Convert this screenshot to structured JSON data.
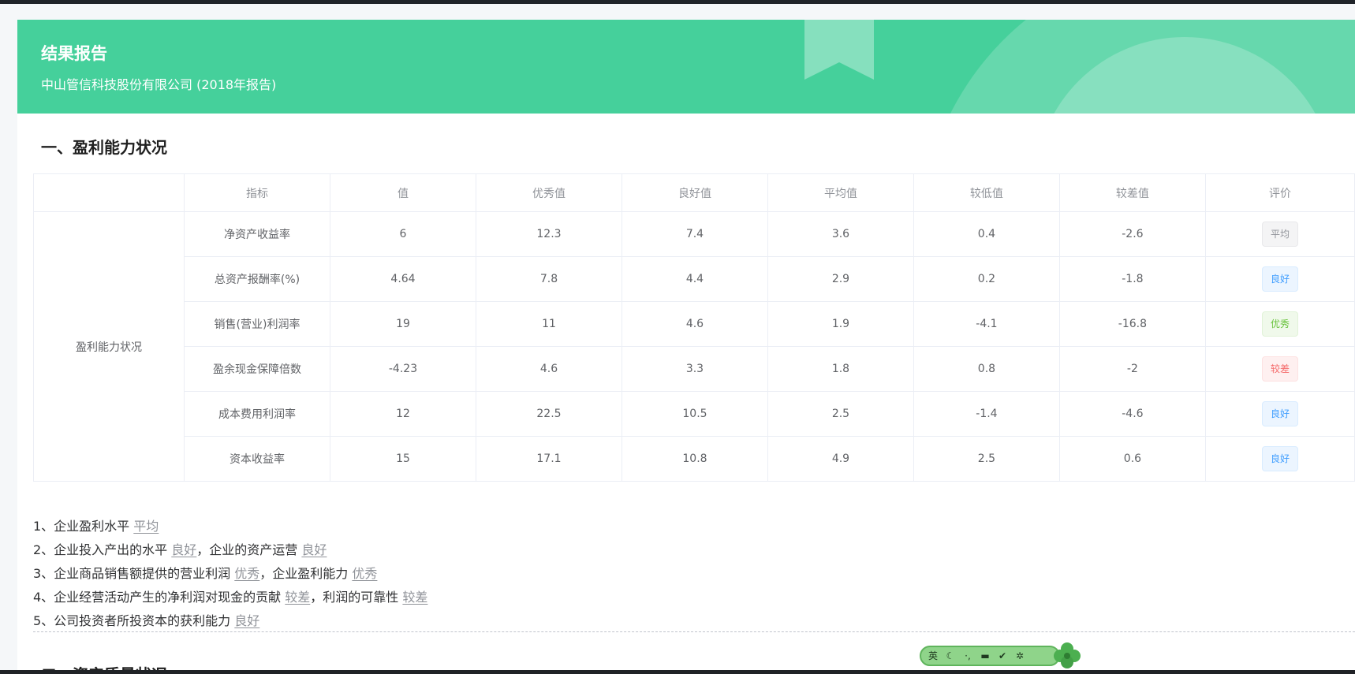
{
  "banner": {
    "title": "结果报告",
    "subtitle": "中山管信科技股份有限公司 (2018年报告)"
  },
  "section1": {
    "title": "一、盈利能力状况",
    "category": "盈利能力状况",
    "headers": [
      "",
      "指标",
      "值",
      "优秀值",
      "良好值",
      "平均值",
      "较低值",
      "较差值",
      "评价"
    ],
    "rows": [
      {
        "name": "净资产收益率",
        "value": "6",
        "excellent": "12.3",
        "good": "7.4",
        "average": "3.6",
        "low": "0.4",
        "poor": "-2.6",
        "rating": "平均"
      },
      {
        "name": "总资产报酬率(%)",
        "value": "4.64",
        "excellent": "7.8",
        "good": "4.4",
        "average": "2.9",
        "low": "0.2",
        "poor": "-1.8",
        "rating": "良好"
      },
      {
        "name": "销售(营业)利润率",
        "value": "19",
        "excellent": "11",
        "good": "4.6",
        "average": "1.9",
        "low": "-4.1",
        "poor": "-16.8",
        "rating": "优秀"
      },
      {
        "name": "盈余现金保障倍数",
        "value": "-4.23",
        "excellent": "4.6",
        "good": "3.3",
        "average": "1.8",
        "low": "0.8",
        "poor": "-2",
        "rating": "较差"
      },
      {
        "name": "成本费用利润率",
        "value": "12",
        "excellent": "22.5",
        "good": "10.5",
        "average": "2.5",
        "low": "-1.4",
        "poor": "-4.6",
        "rating": "良好"
      },
      {
        "name": "资本收益率",
        "value": "15",
        "excellent": "17.1",
        "good": "10.8",
        "average": "4.9",
        "low": "2.5",
        "poor": "0.6",
        "rating": "良好"
      }
    ],
    "conclusions": [
      {
        "parts": [
          {
            "t": "1、企业盈利水平 "
          },
          {
            "t": "平均",
            "u": true
          }
        ]
      },
      {
        "parts": [
          {
            "t": "2、企业投入产出的水平 "
          },
          {
            "t": "良好",
            "u": true
          },
          {
            "t": "，企业的资产运营 "
          },
          {
            "t": "良好",
            "u": true
          }
        ]
      },
      {
        "parts": [
          {
            "t": "3、企业商品销售额提供的营业利润 "
          },
          {
            "t": "优秀",
            "u": true
          },
          {
            "t": "，企业盈利能力 "
          },
          {
            "t": "优秀",
            "u": true
          }
        ]
      },
      {
        "parts": [
          {
            "t": "4、企业经营活动产生的净利润对现金的贡献 "
          },
          {
            "t": "较差",
            "u": true
          },
          {
            "t": "，利润的可靠性 "
          },
          {
            "t": "较差",
            "u": true
          }
        ]
      },
      {
        "parts": [
          {
            "t": "5、公司投资者所投资本的获利能力 "
          },
          {
            "t": "良好",
            "u": true
          }
        ]
      }
    ]
  },
  "section2": {
    "title": "二、资产质量状况"
  },
  "ime": {
    "lang": "英",
    "icons": [
      "moon-icon",
      "punctuation-icon",
      "keyboard-icon",
      "check-icon",
      "settings-icon",
      "clover-icon"
    ]
  },
  "colors": {
    "banner": "#45d09b",
    "tag_average": "#909399",
    "tag_good": "#409eff",
    "tag_excellent": "#67c23a",
    "tag_poor": "#f56c6c"
  }
}
